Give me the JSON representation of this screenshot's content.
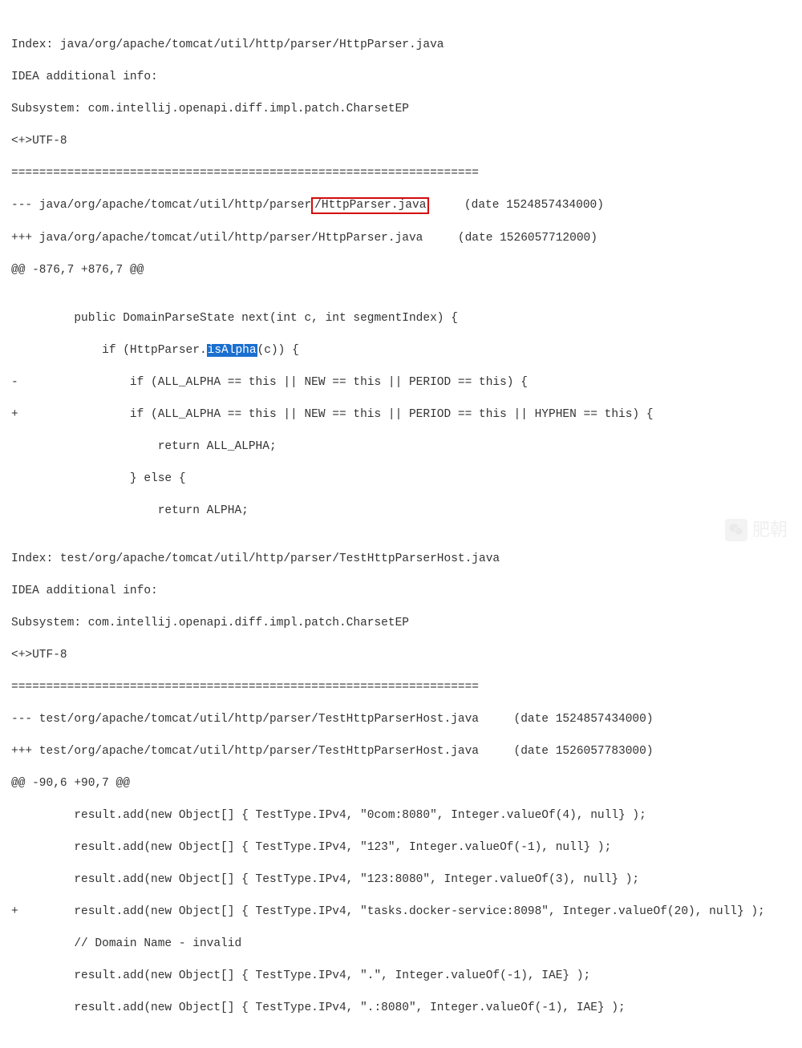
{
  "diff": {
    "file1": {
      "index": "Index: java/org/apache/tomcat/util/http/parser/HttpParser.java",
      "idea": "IDEA additional info:",
      "subsystem": "Subsystem: com.intellij.openapi.diff.impl.patch.CharsetEP",
      "charset": "<+>UTF-8",
      "sep": "===================================================================",
      "minus_prefix": "--- java/org/apache/tomcat/util/http/parser",
      "minus_boxed": "/HttpParser.java",
      "minus_suffix": "     (date 1524857434000)",
      "plus": "+++ java/org/apache/tomcat/util/http/parser/HttpParser.java     (date 1526057712000)",
      "hunk": "@@ -876,7 +876,7 @@",
      "blank": "",
      "ctx1": "         public DomainParseState next(int c, int segmentIndex) {",
      "ctx2_prefix": "             if (HttpParser.",
      "ctx2_hl": "isAlpha",
      "ctx2_suffix": "(c)) {",
      "removed": "-                if (ALL_ALPHA == this || NEW == this || PERIOD == this) {",
      "added": "+                if (ALL_ALPHA == this || NEW == this || PERIOD == this || HYPHEN == this) {",
      "ctx3": "                     return ALL_ALPHA;",
      "ctx4": "                 } else {",
      "ctx5": "                     return ALPHA;"
    },
    "file2": {
      "index": "Index: test/org/apache/tomcat/util/http/parser/TestHttpParserHost.java",
      "idea": "IDEA additional info:",
      "subsystem": "Subsystem: com.intellij.openapi.diff.impl.patch.CharsetEP",
      "charset": "<+>UTF-8",
      "sep": "===================================================================",
      "minus": "--- test/org/apache/tomcat/util/http/parser/TestHttpParserHost.java     (date 1524857434000)",
      "plus": "+++ test/org/apache/tomcat/util/http/parser/TestHttpParserHost.java     (date 1526057783000)",
      "hunk": "@@ -90,6 +90,7 @@",
      "ctx1": "         result.add(new Object[] { TestType.IPv4, \"0com:8080\", Integer.valueOf(4), null} );",
      "ctx2": "         result.add(new Object[] { TestType.IPv4, \"123\", Integer.valueOf(-1), null} );",
      "ctx3": "         result.add(new Object[] { TestType.IPv4, \"123:8080\", Integer.valueOf(3), null} );",
      "added": "+        result.add(new Object[] { TestType.IPv4, \"tasks.docker-service:8098\", Integer.valueOf(20), null} );",
      "ctx4": "         // Domain Name - invalid",
      "ctx5": "         result.add(new Object[] { TestType.IPv4, \".\", Integer.valueOf(-1), IAE} );",
      "ctx6": "         result.add(new Object[] { TestType.IPv4, \".:8080\", Integer.valueOf(-1), IAE} );"
    }
  },
  "watermark": {
    "text": "肥朝"
  }
}
